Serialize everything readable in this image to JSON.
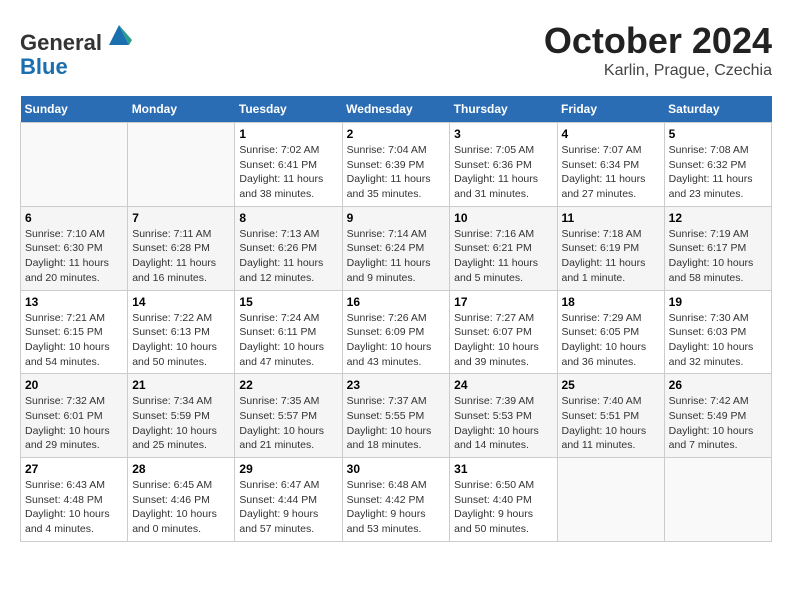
{
  "header": {
    "logo_line1": "General",
    "logo_line2": "Blue",
    "month": "October 2024",
    "location": "Karlin, Prague, Czechia"
  },
  "weekdays": [
    "Sunday",
    "Monday",
    "Tuesday",
    "Wednesday",
    "Thursday",
    "Friday",
    "Saturday"
  ],
  "weeks": [
    [
      {
        "day": "",
        "info": ""
      },
      {
        "day": "",
        "info": ""
      },
      {
        "day": "1",
        "info": "Sunrise: 7:02 AM\nSunset: 6:41 PM\nDaylight: 11 hours and 38 minutes."
      },
      {
        "day": "2",
        "info": "Sunrise: 7:04 AM\nSunset: 6:39 PM\nDaylight: 11 hours and 35 minutes."
      },
      {
        "day": "3",
        "info": "Sunrise: 7:05 AM\nSunset: 6:36 PM\nDaylight: 11 hours and 31 minutes."
      },
      {
        "day": "4",
        "info": "Sunrise: 7:07 AM\nSunset: 6:34 PM\nDaylight: 11 hours and 27 minutes."
      },
      {
        "day": "5",
        "info": "Sunrise: 7:08 AM\nSunset: 6:32 PM\nDaylight: 11 hours and 23 minutes."
      }
    ],
    [
      {
        "day": "6",
        "info": "Sunrise: 7:10 AM\nSunset: 6:30 PM\nDaylight: 11 hours and 20 minutes."
      },
      {
        "day": "7",
        "info": "Sunrise: 7:11 AM\nSunset: 6:28 PM\nDaylight: 11 hours and 16 minutes."
      },
      {
        "day": "8",
        "info": "Sunrise: 7:13 AM\nSunset: 6:26 PM\nDaylight: 11 hours and 12 minutes."
      },
      {
        "day": "9",
        "info": "Sunrise: 7:14 AM\nSunset: 6:24 PM\nDaylight: 11 hours and 9 minutes."
      },
      {
        "day": "10",
        "info": "Sunrise: 7:16 AM\nSunset: 6:21 PM\nDaylight: 11 hours and 5 minutes."
      },
      {
        "day": "11",
        "info": "Sunrise: 7:18 AM\nSunset: 6:19 PM\nDaylight: 11 hours and 1 minute."
      },
      {
        "day": "12",
        "info": "Sunrise: 7:19 AM\nSunset: 6:17 PM\nDaylight: 10 hours and 58 minutes."
      }
    ],
    [
      {
        "day": "13",
        "info": "Sunrise: 7:21 AM\nSunset: 6:15 PM\nDaylight: 10 hours and 54 minutes."
      },
      {
        "day": "14",
        "info": "Sunrise: 7:22 AM\nSunset: 6:13 PM\nDaylight: 10 hours and 50 minutes."
      },
      {
        "day": "15",
        "info": "Sunrise: 7:24 AM\nSunset: 6:11 PM\nDaylight: 10 hours and 47 minutes."
      },
      {
        "day": "16",
        "info": "Sunrise: 7:26 AM\nSunset: 6:09 PM\nDaylight: 10 hours and 43 minutes."
      },
      {
        "day": "17",
        "info": "Sunrise: 7:27 AM\nSunset: 6:07 PM\nDaylight: 10 hours and 39 minutes."
      },
      {
        "day": "18",
        "info": "Sunrise: 7:29 AM\nSunset: 6:05 PM\nDaylight: 10 hours and 36 minutes."
      },
      {
        "day": "19",
        "info": "Sunrise: 7:30 AM\nSunset: 6:03 PM\nDaylight: 10 hours and 32 minutes."
      }
    ],
    [
      {
        "day": "20",
        "info": "Sunrise: 7:32 AM\nSunset: 6:01 PM\nDaylight: 10 hours and 29 minutes."
      },
      {
        "day": "21",
        "info": "Sunrise: 7:34 AM\nSunset: 5:59 PM\nDaylight: 10 hours and 25 minutes."
      },
      {
        "day": "22",
        "info": "Sunrise: 7:35 AM\nSunset: 5:57 PM\nDaylight: 10 hours and 21 minutes."
      },
      {
        "day": "23",
        "info": "Sunrise: 7:37 AM\nSunset: 5:55 PM\nDaylight: 10 hours and 18 minutes."
      },
      {
        "day": "24",
        "info": "Sunrise: 7:39 AM\nSunset: 5:53 PM\nDaylight: 10 hours and 14 minutes."
      },
      {
        "day": "25",
        "info": "Sunrise: 7:40 AM\nSunset: 5:51 PM\nDaylight: 10 hours and 11 minutes."
      },
      {
        "day": "26",
        "info": "Sunrise: 7:42 AM\nSunset: 5:49 PM\nDaylight: 10 hours and 7 minutes."
      }
    ],
    [
      {
        "day": "27",
        "info": "Sunrise: 6:43 AM\nSunset: 4:48 PM\nDaylight: 10 hours and 4 minutes."
      },
      {
        "day": "28",
        "info": "Sunrise: 6:45 AM\nSunset: 4:46 PM\nDaylight: 10 hours and 0 minutes."
      },
      {
        "day": "29",
        "info": "Sunrise: 6:47 AM\nSunset: 4:44 PM\nDaylight: 9 hours and 57 minutes."
      },
      {
        "day": "30",
        "info": "Sunrise: 6:48 AM\nSunset: 4:42 PM\nDaylight: 9 hours and 53 minutes."
      },
      {
        "day": "31",
        "info": "Sunrise: 6:50 AM\nSunset: 4:40 PM\nDaylight: 9 hours and 50 minutes."
      },
      {
        "day": "",
        "info": ""
      },
      {
        "day": "",
        "info": ""
      }
    ]
  ]
}
